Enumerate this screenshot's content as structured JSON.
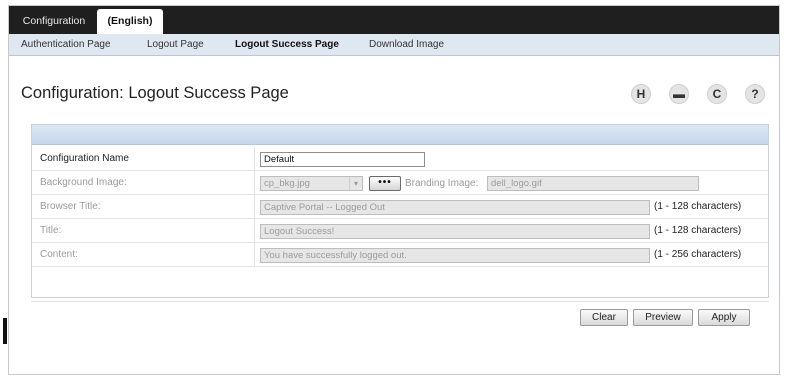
{
  "top_tabs": [
    "Configuration",
    "(English)"
  ],
  "sub_nav": [
    "Authentication Page",
    "Logout Page",
    "Logout Success Page",
    "Download Image"
  ],
  "page_title": "Configuration: Logout Success Page",
  "toolbar_icons": [
    {
      "name": "save-icon",
      "glyph": "H"
    },
    {
      "name": "print-icon",
      "glyph": "▬"
    },
    {
      "name": "refresh-icon",
      "glyph": "C"
    },
    {
      "name": "help-icon",
      "glyph": "?"
    }
  ],
  "form": {
    "config_name": {
      "label": "Configuration Name",
      "value": "Default"
    },
    "background_image": {
      "label": "Background Image:",
      "value": "cp_bkg.jpg",
      "button": "•••"
    },
    "branding_image": {
      "label": "Branding Image:",
      "value": "dell_logo.gif"
    },
    "browser_title": {
      "label": "Browser Title:",
      "value": "Captive Portal -- Logged Out",
      "hint": "(1 - 128 characters)"
    },
    "title": {
      "label": "Title:",
      "value": "Logout Success!",
      "hint": "(1 - 128 characters)"
    },
    "content": {
      "label": "Content:",
      "value": "You have successfully logged out.",
      "hint": "(1 - 256 characters)"
    }
  },
  "buttons": {
    "clear": "Clear",
    "preview": "Preview",
    "apply": "Apply"
  }
}
